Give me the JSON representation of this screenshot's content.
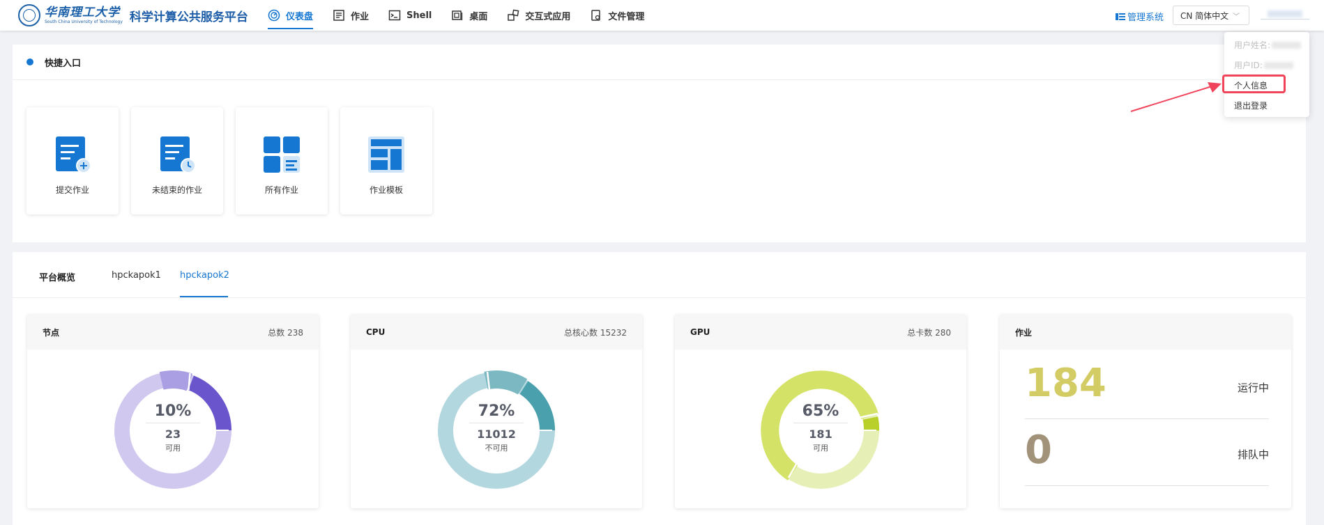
{
  "header": {
    "logo_text": "华南理工大学",
    "logo_en": "South China University of Technology",
    "platform_name": "科学计算公共服务平台",
    "nav": [
      {
        "label": "仪表盘",
        "icon": "dashboard-icon",
        "active": true
      },
      {
        "label": "作业",
        "icon": "job-list-icon",
        "active": false
      },
      {
        "label": "Shell",
        "icon": "terminal-icon",
        "active": false
      },
      {
        "label": "桌面",
        "icon": "desktop-icon",
        "active": false
      },
      {
        "label": "交互式应用",
        "icon": "apps-icon",
        "active": false
      },
      {
        "label": "文件管理",
        "icon": "file-icon",
        "active": false
      }
    ],
    "admin_label": "管理系统",
    "lang_label": "CN 简体中文"
  },
  "user_menu": {
    "name_label": "用户姓名:",
    "id_label": "用户ID:",
    "profile": "个人信息",
    "logout": "退出登录"
  },
  "quick_entry": {
    "title": "快捷入口",
    "tiles": [
      {
        "label": "提交作业",
        "icon": "submit-job-icon"
      },
      {
        "label": "未结束的作业",
        "icon": "running-jobs-icon"
      },
      {
        "label": "所有作业",
        "icon": "all-jobs-icon"
      },
      {
        "label": "作业模板",
        "icon": "job-template-icon"
      }
    ]
  },
  "overview": {
    "tabs": [
      "平台概览",
      "hpckapok1",
      "hpckapok2"
    ],
    "active_tab": "hpckapok2",
    "nodes": {
      "title": "节点",
      "total": "总数 238",
      "percent": "10%",
      "count": "23",
      "label": "可用"
    },
    "cpu": {
      "title": "CPU",
      "total": "总核心数 15232",
      "percent": "72%",
      "count": "11012",
      "label": "不可用"
    },
    "gpu": {
      "title": "GPU",
      "total": "总卡数 280",
      "percent": "65%",
      "count": "181",
      "label": "可用"
    },
    "jobs": {
      "title": "作业",
      "running": "184",
      "running_label": "运行中",
      "queued": "0",
      "queued_label": "排队中"
    }
  },
  "colors": {
    "accent": "#1677d2",
    "nodes_main": "#d0c8ee",
    "nodes_mid": "#a99fe2",
    "nodes_dark": "#6a55cc",
    "cpu_main": "#b2d7de",
    "cpu_mid": "#7bb8c2",
    "cpu_dark": "#4aa0ad",
    "gpu_main": "#d4e267",
    "gpu_light": "#e6efb6",
    "gpu_dark": "#b9d02b",
    "running": "#d3cb64",
    "queued": "#a19279",
    "highlight": "#f0445b"
  }
}
